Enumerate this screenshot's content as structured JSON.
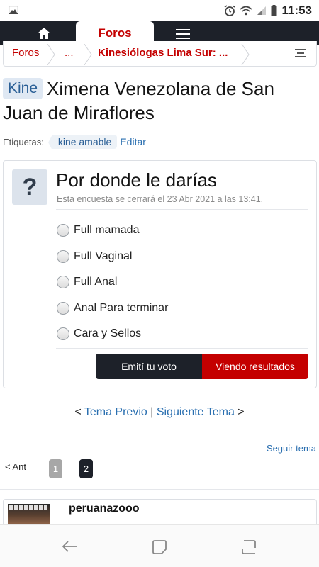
{
  "status_bar": {
    "time": "11:53",
    "icons": [
      "image-icon",
      "alarm-icon",
      "wifi-icon",
      "signal-icon",
      "battery-icon"
    ]
  },
  "nav": {
    "home_icon": "home-icon",
    "active_tab": "Foros",
    "menu_icon": "hamburger-icon"
  },
  "breadcrumb": {
    "items": [
      "Foros",
      "...",
      "Kinesiólogas Lima Sur: ..."
    ],
    "jump_icon": "list-icon"
  },
  "thread": {
    "prefix": "Kine",
    "title": "Ximena Venezolana de San Juan de Miraflores"
  },
  "tags": {
    "label": "Etiquetas:",
    "items": [
      "kine amable"
    ],
    "edit": "Editar"
  },
  "poll": {
    "icon": "?",
    "question": "Por donde le darías",
    "closes": "Esta encuesta se cerrará el 23 Abr 2021 a las 13:41.",
    "options": [
      "Full mamada",
      "Full Vaginal",
      "Full Anal",
      "Anal Para terminar",
      "Cara y Sellos"
    ],
    "vote_button": "Emití tu voto",
    "results_button": "Viendo resultados"
  },
  "thread_nav": {
    "prev_arrow": "<",
    "prev": "Tema Previo",
    "separator": "|",
    "next": "Siguiente Tema",
    "next_arrow": ">"
  },
  "follow": "Seguir tema",
  "pagination": {
    "prev": "< Ant",
    "pages": [
      "1",
      "2"
    ],
    "current": "2"
  },
  "post": {
    "username": "peruanazooo"
  },
  "colors": {
    "brand_red": "#c40000",
    "dark": "#1d2129",
    "link": "#2a6fb0"
  }
}
